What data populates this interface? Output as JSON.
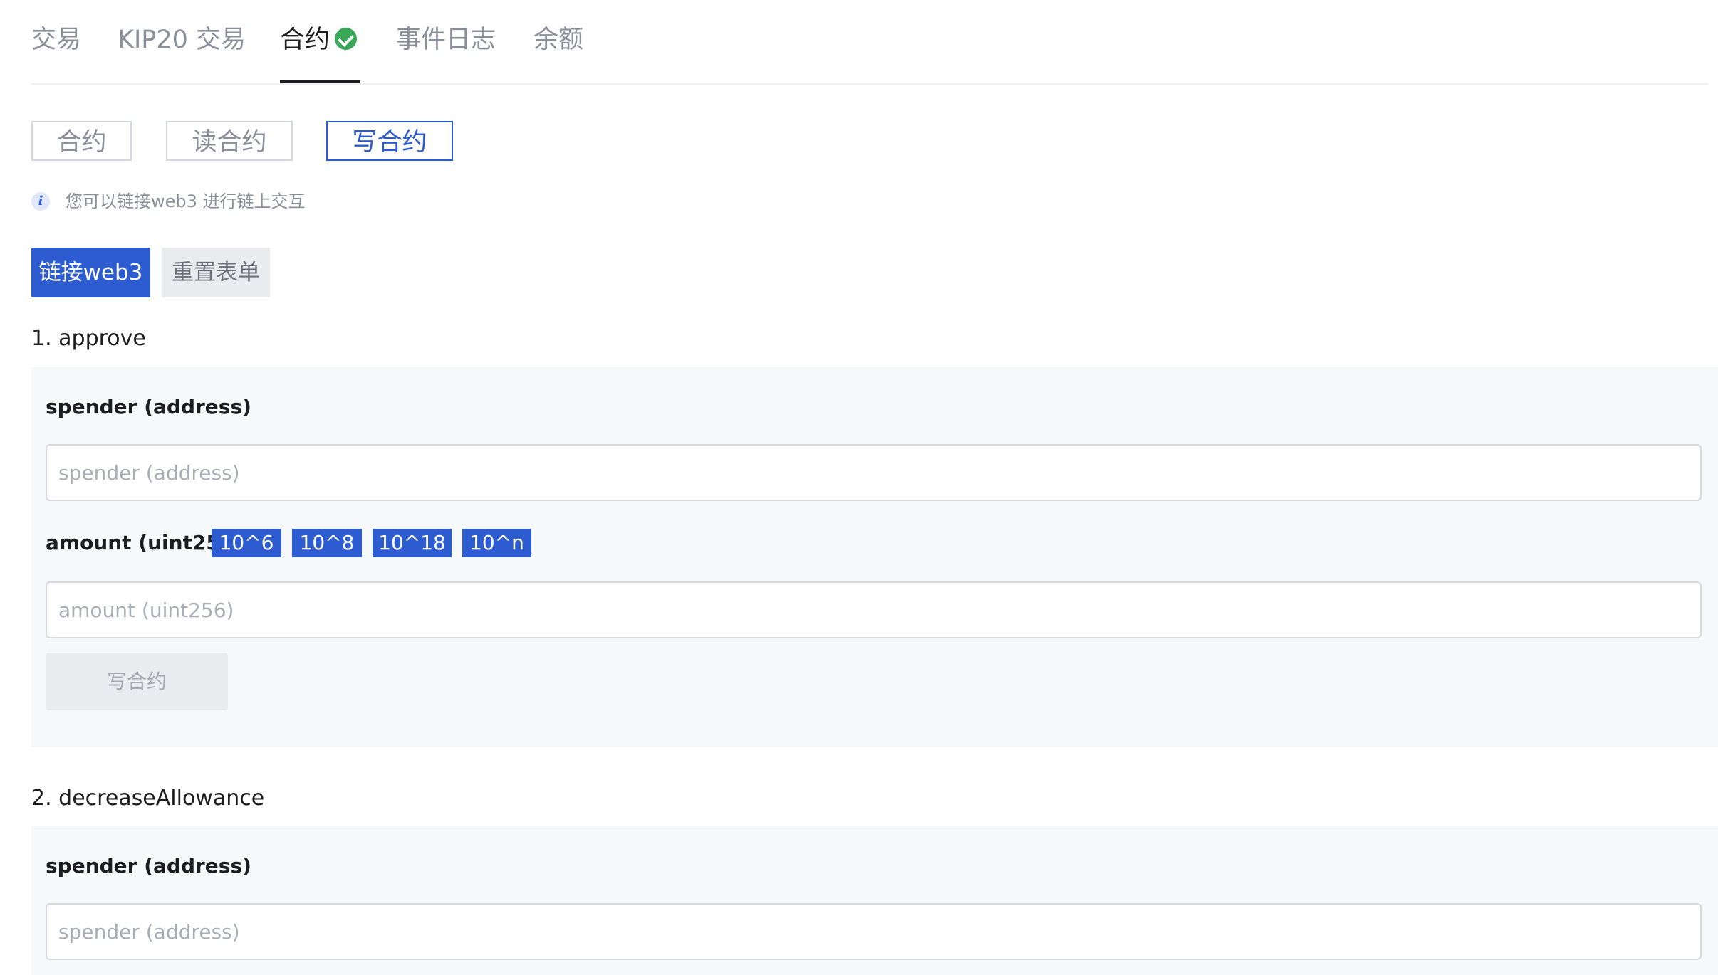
{
  "tabs": [
    {
      "label": "交易"
    },
    {
      "label": "KIP20 交易"
    },
    {
      "label": "合约"
    },
    {
      "label": "事件日志"
    },
    {
      "label": "余额"
    }
  ],
  "active_tab": "合约",
  "verified_icon": "check-circle-icon",
  "subtabs": [
    {
      "label": "合约"
    },
    {
      "label": "读合约"
    },
    {
      "label": "写合约"
    }
  ],
  "active_subtab": "写合约",
  "info": {
    "icon": "info-icon",
    "text": "您可以链接web3 进行链上交互"
  },
  "actions": {
    "connect_label": "链接web3",
    "reset_label": "重置表单"
  },
  "colors": {
    "primary": "#2d5bd0",
    "success": "#3aa657",
    "panel_bg": "#f7f8fa"
  },
  "functions": [
    {
      "title": "1. approve",
      "spender_label": "spender (address)",
      "spender_placeholder": "spender (address)",
      "amount_label": "amount (uint256)",
      "amount_placeholder": "amount (uint256)",
      "chips": [
        "10^6",
        "10^8",
        "10^18",
        "10^n"
      ],
      "write_label": "写合约"
    },
    {
      "title": "2. decreaseAllowance",
      "spender_label": "spender (address)",
      "spender_placeholder": "spender (address)"
    }
  ]
}
